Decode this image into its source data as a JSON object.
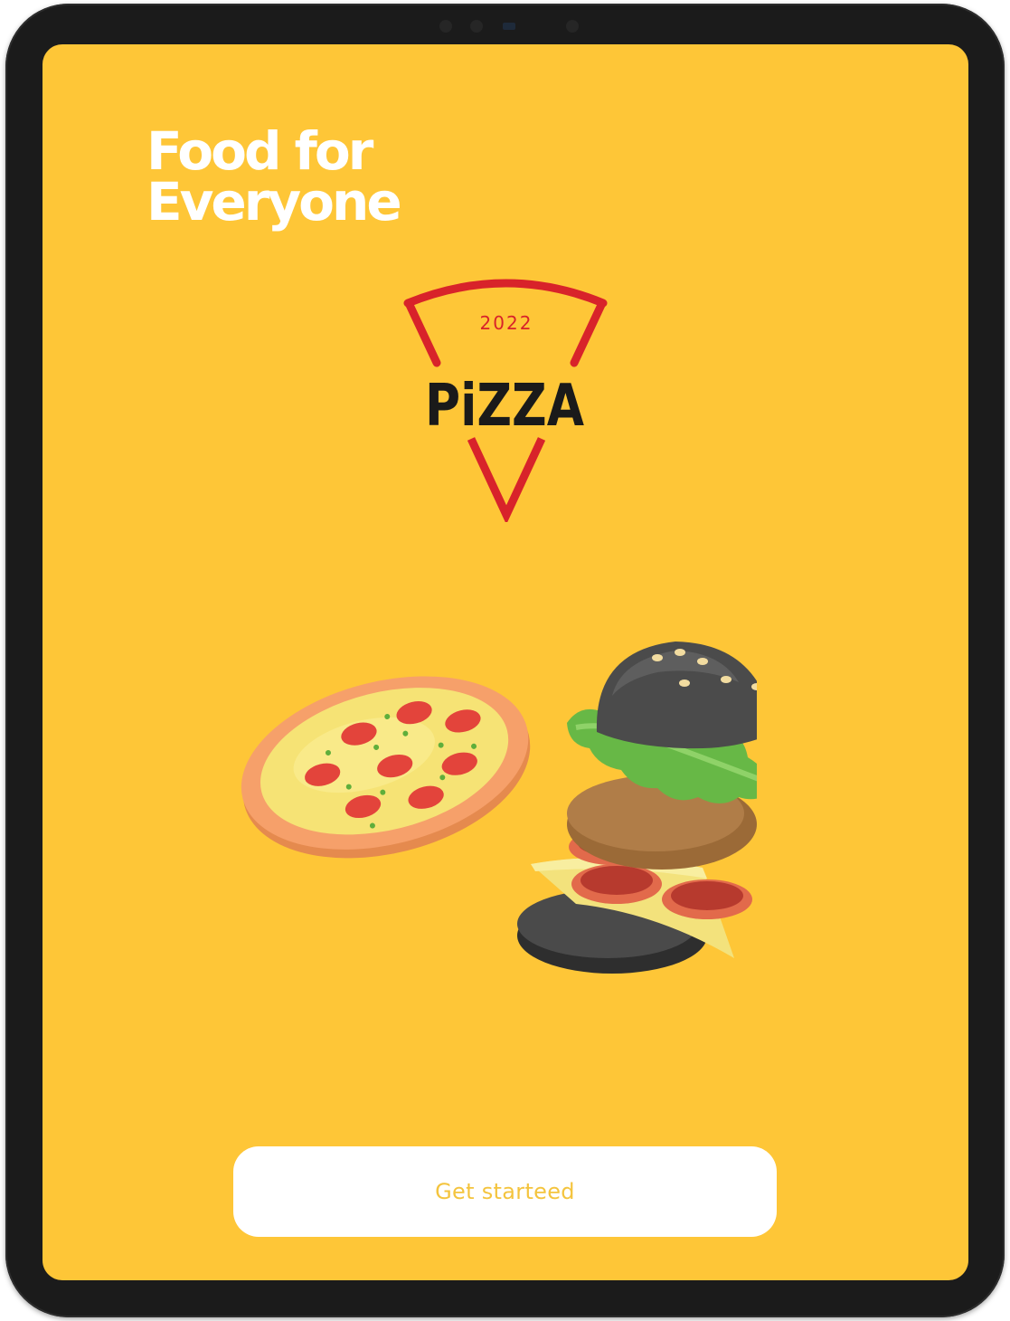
{
  "colors": {
    "background": "#fec637",
    "headline_text": "#ffffff",
    "button_background": "#ffffff",
    "button_text": "#f4c43e",
    "logo_red": "#d8232a",
    "logo_black": "#1a1a1a",
    "device_bezel": "#1b1b1b"
  },
  "headline": {
    "line1": "Food for",
    "line2": "Everyone"
  },
  "logo": {
    "year": "2022",
    "word": "PiZZA",
    "icon": "pizza-slice-outline-icon"
  },
  "illustration": {
    "items": [
      "pizza",
      "burger"
    ]
  },
  "cta": {
    "label": "Get starteed"
  }
}
